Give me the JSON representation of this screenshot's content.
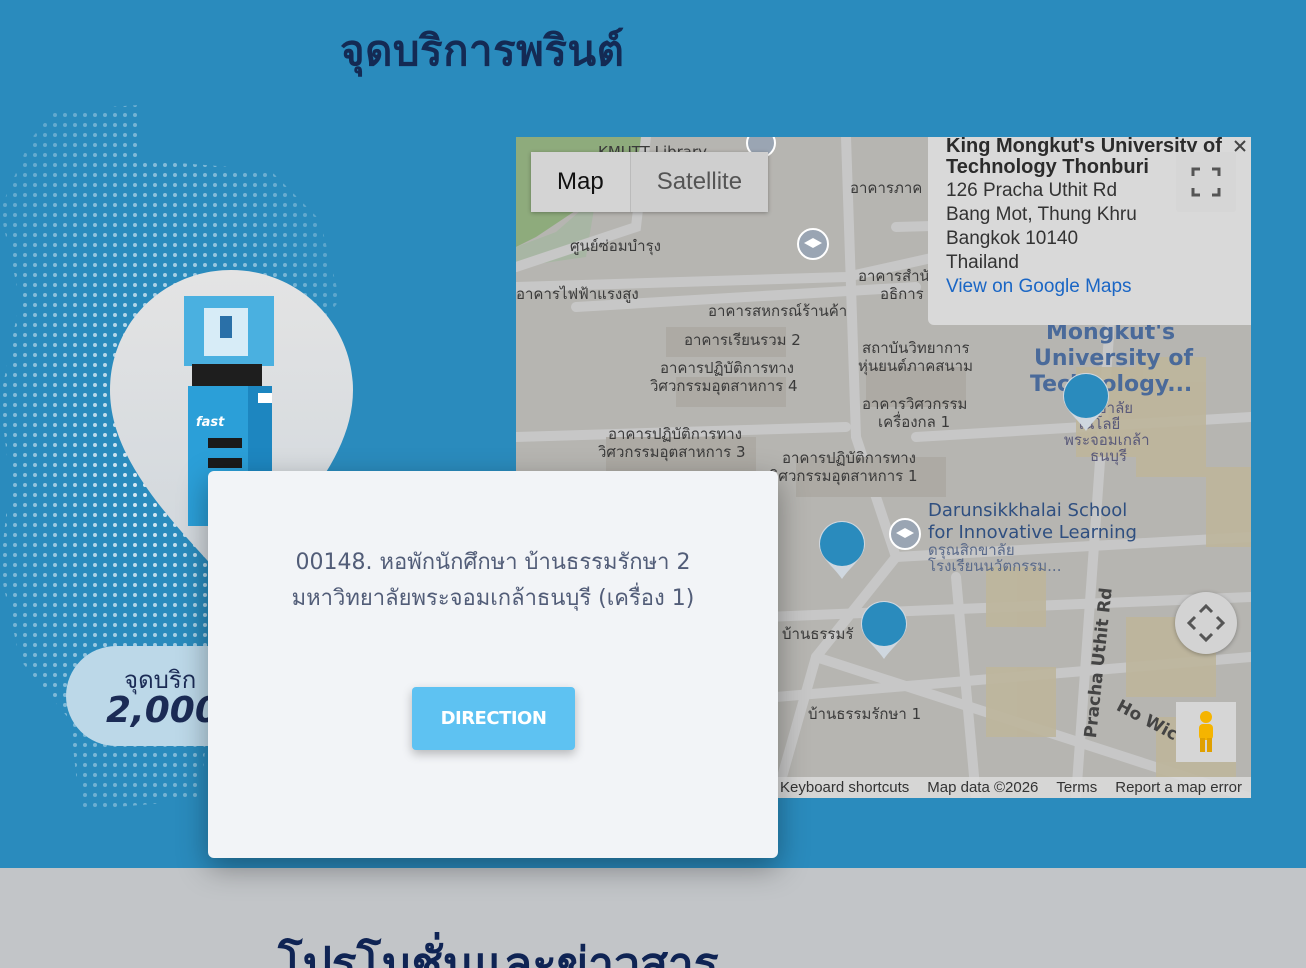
{
  "section": {
    "title": "จุดบริการพรินต์",
    "counter_label": "จุดบริก",
    "counter_value": "2,000"
  },
  "promo": {
    "title": "โปรโมชั่นและข่าวสาร"
  },
  "map": {
    "type_controls": {
      "map_label": "Map",
      "satellite_label": "Satellite"
    },
    "info_card": {
      "name_line1": "King Mongkut's University of",
      "name_line2": "Technology Thonburi",
      "address_line1": "126 Pracha Uthit Rd",
      "address_line2": "Bang Mot, Thung Khru",
      "address_line3": "Bangkok 10140",
      "address_line4": "Thailand",
      "link_label": "View on Google Maps"
    },
    "labels": {
      "kmutt_library": "KMUTT Library",
      "repair_center": "ศูนย์ซ่อมบำรุง",
      "high_voltage": "อาคารไฟฟ้าแรงสูง",
      "coop_store": "อาคารสหกรณ์ร้านค้า",
      "lecture_bldg_2": "อาคารเรียนรวม 2",
      "eng_lab_4_l1": "อาคารปฏิบัติการทาง",
      "eng_lab_4_l2": "วิศวกรรมอุตสาหการ 4",
      "eng_lab_3_l1": "อาคารปฏิบัติการทาง",
      "eng_lab_3_l2": "วิศวกรรมอุตสาหการ 3",
      "eng_lab_1_l1": "อาคารปฏิบัติการทาง",
      "eng_lab_1_l2": "วิศวกรรมอุตสาหการ 1",
      "field_robotics_l1": "สถาบันวิทยาการ",
      "field_robotics_l2": "หุ่นยนต์ภาคสนาม",
      "engineering_bldg_l1": "อาคารวิศวกรรม",
      "engineering_bldg_l2": "เครื่องกล 1",
      "office_bldg_l1": "อาคารสำนั",
      "office_bldg_l2": "อธิการ",
      "bldg_top": "อาคารภาค",
      "kmutt_big_l1": "Mongkut's",
      "kmutt_big_l2": "University of",
      "kmutt_big_l3": "Technology...",
      "kmutt_thai_l1": "ทยาลัย",
      "kmutt_thai_l2": "โนโลยี",
      "kmutt_thai_l3": "พระจอมเกล้า",
      "kmutt_thai_l4": "ธนบุรี",
      "school_l1": "Darunsikkhalai School",
      "school_l2": "for Innovative Learning",
      "school_thai_l1": "ดรุณสิกขาลัย",
      "school_thai_l2": "โรงเรียนนวัตกรรม...",
      "dorm_2": "บ้านธรรมรั",
      "dorm_1": "บ้านธรรมรักษา 1",
      "road_pracha": "Pracha Uthit Rd",
      "road_ho": "Ho Wic"
    },
    "attribution": {
      "shortcuts": "Keyboard shortcuts",
      "map_data": "Map data ©2026",
      "terms": "Terms",
      "report": "Report a map error"
    },
    "marker_color": "#2a8bbd"
  },
  "modal": {
    "line1": "00148. หอพักนักศึกษา บ้านธรรมรักษา 2",
    "line2": "มหาวิทยาลัยพระจอมเกล้าธนบุรี (เครื่อง 1)",
    "direction_label": "DIRECTION",
    "button_color": "#5ec2f2"
  }
}
